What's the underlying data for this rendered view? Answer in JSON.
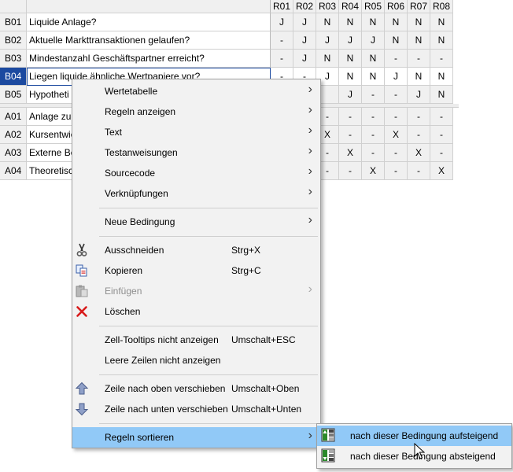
{
  "table": {
    "columns": [
      "R01",
      "R02",
      "R03",
      "R04",
      "R05",
      "R06",
      "R07",
      "R08"
    ],
    "conditions": [
      {
        "id": "B01",
        "text": "Liquide Anlage?",
        "values": [
          "J",
          "J",
          "N",
          "N",
          "N",
          "N",
          "N",
          "N"
        ]
      },
      {
        "id": "B02",
        "text": "Aktuelle Markttransaktionen gelaufen?",
        "values": [
          "-",
          "J",
          "J",
          "J",
          "J",
          "N",
          "N",
          "N"
        ]
      },
      {
        "id": "B03",
        "text": "Mindestanzahl Geschäftspartner erreicht?",
        "values": [
          "-",
          "J",
          "N",
          "N",
          "N",
          "-",
          "-",
          "-"
        ]
      },
      {
        "id": "B04",
        "text": "Liegen liquide ähnliche Wertpapiere vor?",
        "values": [
          "-",
          "-",
          "J",
          "N",
          "N",
          "J",
          "N",
          "N"
        ]
      },
      {
        "id": "B05",
        "text": "Hypotheti",
        "values": [
          "",
          "",
          "",
          "J",
          "-",
          "-",
          "J",
          "N"
        ]
      }
    ],
    "actions": [
      {
        "id": "A01",
        "text": "Anlage zu",
        "values": [
          "",
          "",
          "-",
          "-",
          "-",
          "-",
          "-",
          "-"
        ]
      },
      {
        "id": "A02",
        "text": "Kursentwic",
        "values": [
          "",
          "",
          "X",
          "-",
          "-",
          "X",
          "-",
          "-"
        ]
      },
      {
        "id": "A03",
        "text": "Externe Be",
        "values": [
          "",
          "",
          "-",
          "X",
          "-",
          "-",
          "X",
          "-"
        ]
      },
      {
        "id": "A04",
        "text": "Theoretisc",
        "values": [
          "",
          "",
          "-",
          "-",
          "X",
          "-",
          "-",
          "X"
        ]
      }
    ]
  },
  "menu": {
    "items": [
      {
        "name": "wertetabelle",
        "label": "Wertetabelle",
        "submenu": true
      },
      {
        "name": "regeln-anzeigen",
        "label": "Regeln anzeigen",
        "submenu": true
      },
      {
        "name": "text",
        "label": "Text",
        "submenu": true
      },
      {
        "name": "testanweisungen",
        "label": "Testanweisungen",
        "submenu": true
      },
      {
        "name": "sourcecode",
        "label": "Sourcecode",
        "submenu": true
      },
      {
        "name": "verknuepfungen",
        "label": "Verknüpfungen",
        "submenu": true
      },
      {
        "sep": true
      },
      {
        "name": "neue-bedingung",
        "label": "Neue Bedingung",
        "submenu": true
      },
      {
        "sep": true
      },
      {
        "name": "ausschneiden",
        "label": "Ausschneiden",
        "shortcut": "Strg+X",
        "icon": "scissors-icon"
      },
      {
        "name": "kopieren",
        "label": "Kopieren",
        "shortcut": "Strg+C",
        "icon": "copy-icon"
      },
      {
        "name": "einfuegen",
        "label": "Einfügen",
        "submenu": true,
        "disabled": true,
        "icon": "paste-icon"
      },
      {
        "name": "loeschen",
        "label": "Löschen",
        "icon": "delete-icon"
      },
      {
        "sep": true
      },
      {
        "name": "zell-tooltips",
        "label": "Zell-Tooltips nicht anzeigen",
        "shortcut": "Umschalt+ESC"
      },
      {
        "name": "leere-zeilen",
        "label": "Leere Zeilen nicht anzeigen"
      },
      {
        "sep": true
      },
      {
        "name": "zeile-nach-oben",
        "label": "Zeile nach oben verschieben",
        "shortcut": "Umschalt+Oben",
        "icon": "arrow-up-icon"
      },
      {
        "name": "zeile-nach-unten",
        "label": "Zeile nach unten verschieben",
        "shortcut": "Umschalt+Unten",
        "icon": "arrow-down-icon"
      },
      {
        "sep": true
      },
      {
        "name": "regeln-sortieren",
        "label": "Regeln sortieren",
        "submenu": true,
        "highlighted": true
      }
    ]
  },
  "submenu": {
    "items": [
      {
        "name": "aufsteigend",
        "label": "nach dieser Bedingung aufsteigend",
        "icon": "sort-ascending-icon",
        "highlighted": true
      },
      {
        "name": "absteigend",
        "label": "nach dieser Bedingung absteigend",
        "icon": "sort-descending-icon"
      }
    ]
  },
  "colors": {
    "selection": "#1c4aa0",
    "highlight": "#91c9f7",
    "delete": "#d81b1b"
  }
}
